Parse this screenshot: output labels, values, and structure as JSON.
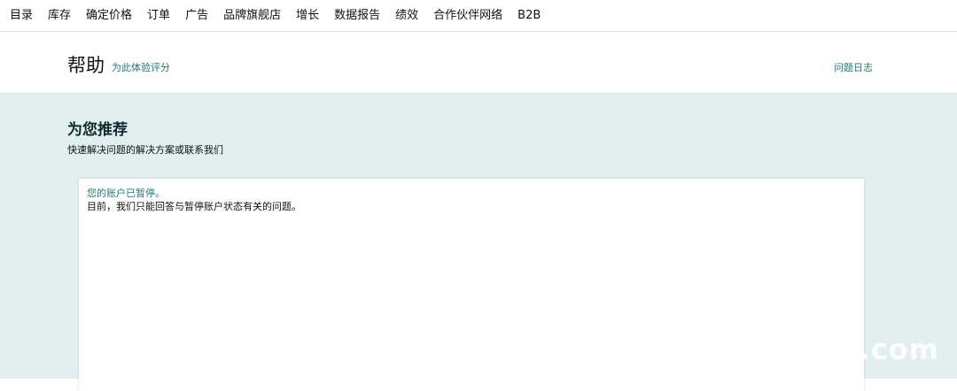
{
  "topnav": {
    "items": [
      {
        "label": "目录"
      },
      {
        "label": "库存"
      },
      {
        "label": "确定价格"
      },
      {
        "label": "订单"
      },
      {
        "label": "广告"
      },
      {
        "label": "品牌旗舰店"
      },
      {
        "label": "增长"
      },
      {
        "label": "数据报告"
      },
      {
        "label": "绩效"
      },
      {
        "label": "合作伙伴网络"
      },
      {
        "label": "B2B"
      }
    ]
  },
  "header": {
    "title": "帮助",
    "rate_link": "为此体验评分",
    "log_link": "问题日志"
  },
  "recommend": {
    "title": "为您推荐",
    "subtitle": "快速解决问题的解决方案或联系我们"
  },
  "card": {
    "alert_link": "您的账户已暂停。",
    "alert_text": "目前，我们只能回答与暂停账户状态有关的问题。"
  },
  "watermark": {
    "text": ".com"
  },
  "colors": {
    "link": "#217a78",
    "main_bg": "#e2efef",
    "title": "#0f2b2e"
  }
}
